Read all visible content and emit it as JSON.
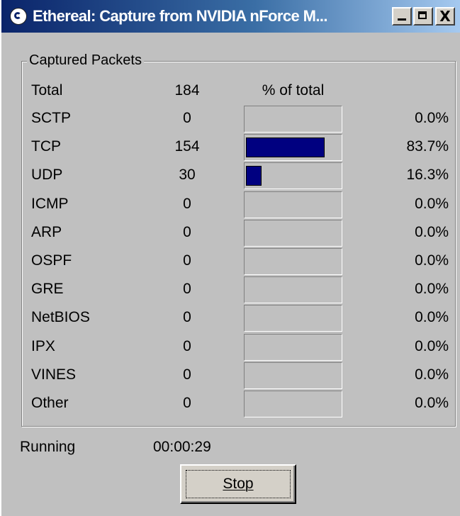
{
  "window": {
    "title": "Ethereal: Capture from NVIDIA nForce M...",
    "minimize_icon": "minimize-icon",
    "maximize_icon": "maximize-icon",
    "close_glyph": "X"
  },
  "group": {
    "label": "Captured Packets",
    "header": {
      "name": "Total",
      "count": "184",
      "pct_label": "% of total"
    },
    "rows": [
      {
        "name": "SCTP",
        "count": "0",
        "pct": "0.0%",
        "fraction": 0.0
      },
      {
        "name": "TCP",
        "count": "154",
        "pct": "83.7%",
        "fraction": 0.837
      },
      {
        "name": "UDP",
        "count": "30",
        "pct": "16.3%",
        "fraction": 0.163
      },
      {
        "name": "ICMP",
        "count": "0",
        "pct": "0.0%",
        "fraction": 0.0
      },
      {
        "name": "ARP",
        "count": "0",
        "pct": "0.0%",
        "fraction": 0.0
      },
      {
        "name": "OSPF",
        "count": "0",
        "pct": "0.0%",
        "fraction": 0.0
      },
      {
        "name": "GRE",
        "count": "0",
        "pct": "0.0%",
        "fraction": 0.0
      },
      {
        "name": "NetBIOS",
        "count": "0",
        "pct": "0.0%",
        "fraction": 0.0
      },
      {
        "name": "IPX",
        "count": "0",
        "pct": "0.0%",
        "fraction": 0.0
      },
      {
        "name": "VINES",
        "count": "0",
        "pct": "0.0%",
        "fraction": 0.0
      },
      {
        "name": "Other",
        "count": "0",
        "pct": "0.0%",
        "fraction": 0.0
      }
    ]
  },
  "status": {
    "label": "Running",
    "elapsed": "00:00:29"
  },
  "stop_button": {
    "label": "Stop"
  },
  "colors": {
    "bar_fill": "#000080",
    "title_start": "#0a246a",
    "title_end": "#a6caf0"
  }
}
